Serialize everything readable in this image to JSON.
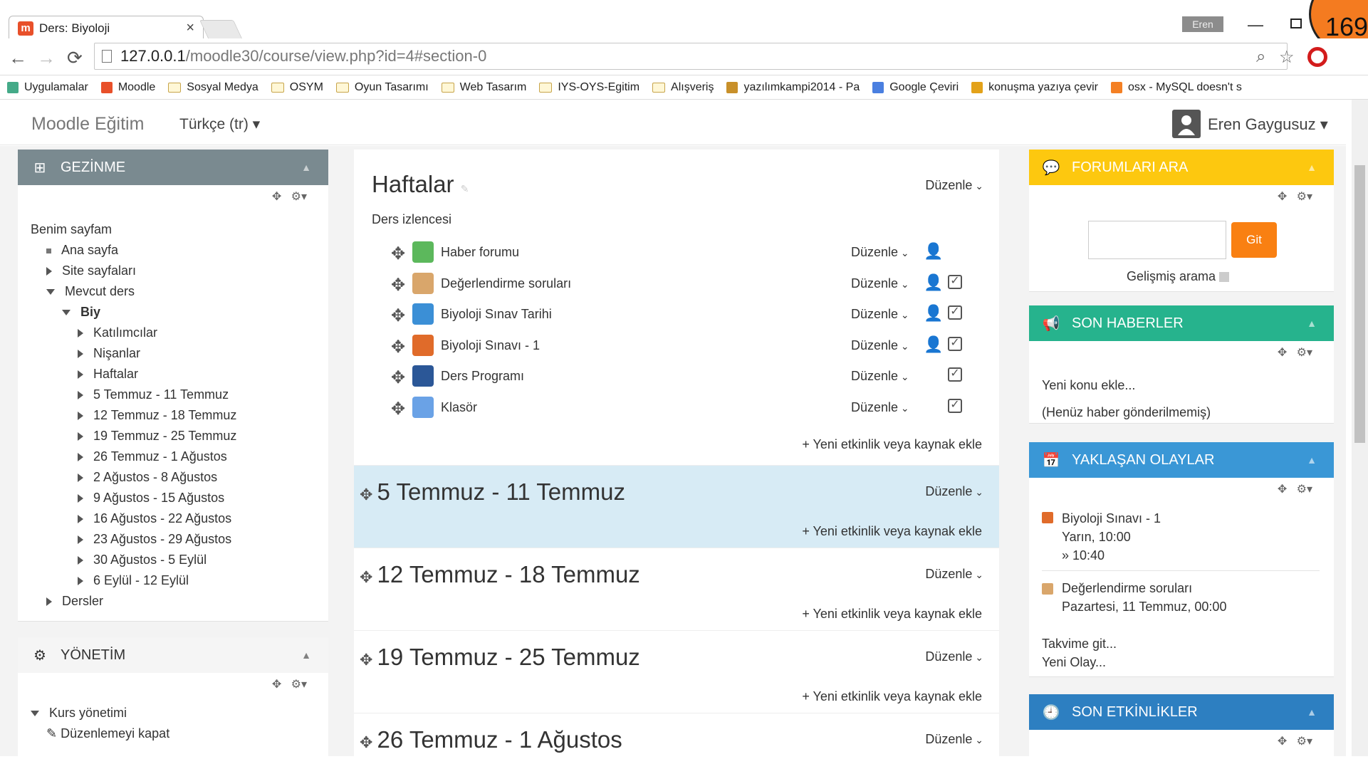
{
  "browser": {
    "tab_title": "Ders: Biyoloji",
    "tab_close": "×",
    "user_chip": "Eren",
    "counter": "169",
    "url_host": "127.0.0.1",
    "url_path": "/moodle30/course/view.php?id=4#section-0",
    "bookmarks": [
      {
        "label": "Uygulamalar",
        "icon": "apps-grid-icon"
      },
      {
        "label": "Moodle",
        "icon": "moodle-icon"
      },
      {
        "label": "Sosyal Medya",
        "icon": "folder-icon"
      },
      {
        "label": "OSYM",
        "icon": "folder-icon"
      },
      {
        "label": "Oyun Tasarımı",
        "icon": "folder-icon"
      },
      {
        "label": "Web Tasarım",
        "icon": "folder-icon"
      },
      {
        "label": "IYS-OYS-Egitim",
        "icon": "folder-icon"
      },
      {
        "label": "Alışveriş",
        "icon": "folder-icon"
      },
      {
        "label": "yazılımkampi2014 - Pa",
        "icon": "leopard-icon"
      },
      {
        "label": "Google Çeviri",
        "icon": "translate-icon"
      },
      {
        "label": "konuşma yazıya çevir",
        "icon": "chrome-icon"
      },
      {
        "label": "osx - MySQL doesn't s",
        "icon": "stack-icon"
      }
    ]
  },
  "navbar": {
    "brand": "Moodle Eğitim",
    "language": "Türkçe (tr)",
    "user_name": "Eren Gaygusuz"
  },
  "left": {
    "nav_title": "GEZİNME",
    "nav_tree": [
      {
        "label": "Benim sayfam",
        "level": 0,
        "marker": "none"
      },
      {
        "label": "Ana sayfa",
        "level": 1,
        "marker": "dot"
      },
      {
        "label": "Site sayfaları",
        "level": 1,
        "marker": "right"
      },
      {
        "label": "Mevcut ders",
        "level": 1,
        "marker": "down"
      },
      {
        "label": "Biy",
        "level": 2,
        "marker": "down"
      },
      {
        "label": "Katılımcılar",
        "level": 3,
        "marker": "right"
      },
      {
        "label": "Nişanlar",
        "level": 3,
        "marker": "right"
      },
      {
        "label": "Haftalar",
        "level": 3,
        "marker": "right"
      },
      {
        "label": "5 Temmuz - 11 Temmuz",
        "level": 3,
        "marker": "right"
      },
      {
        "label": "12 Temmuz - 18 Temmuz",
        "level": 3,
        "marker": "right"
      },
      {
        "label": "19 Temmuz - 25 Temmuz",
        "level": 3,
        "marker": "right"
      },
      {
        "label": "26 Temmuz - 1 Ağustos",
        "level": 3,
        "marker": "right"
      },
      {
        "label": "2 Ağustos - 8 Ağustos",
        "level": 3,
        "marker": "right"
      },
      {
        "label": "9 Ağustos - 15 Ağustos",
        "level": 3,
        "marker": "right"
      },
      {
        "label": "16 Ağustos - 22 Ağustos",
        "level": 3,
        "marker": "right"
      },
      {
        "label": "23 Ağustos - 29 Ağustos",
        "level": 3,
        "marker": "right"
      },
      {
        "label": "30 Ağustos - 5 Eylül",
        "level": 3,
        "marker": "right"
      },
      {
        "label": "6 Eylül - 12 Eylül",
        "level": 3,
        "marker": "right"
      },
      {
        "label": "Dersler",
        "level": 1,
        "marker": "right"
      }
    ],
    "admin_title": "YÖNETİM",
    "admin_tree": [
      {
        "label": "Kurs yönetimi",
        "marker": "down"
      },
      {
        "label": "Düzenlemeyi kapat",
        "marker": "pencil"
      }
    ]
  },
  "main": {
    "edit_label": "Düzenle",
    "add_label": "Yeni etkinlik veya kaynak ekle",
    "section0_title": "Haftalar",
    "section0_summary": "Ders izlencesi",
    "activities": [
      {
        "name": "Haber forumu",
        "icon": "forum-icon",
        "color": "#5cb85c",
        "checkbox": false
      },
      {
        "name": "Değerlendirme soruları",
        "icon": "feedback-icon",
        "color": "#d9a66b",
        "checkbox": true
      },
      {
        "name": "Biyoloji Sınav Tarihi",
        "icon": "question-icon",
        "color": "#3b8fd6",
        "checkbox": true
      },
      {
        "name": "Biyoloji Sınavı - 1",
        "icon": "quiz-icon",
        "color": "#e06b2a",
        "checkbox": true
      },
      {
        "name": "Ders Programı",
        "icon": "word-doc-icon",
        "color": "#2b5797",
        "checkbox": true
      },
      {
        "name": "Klasör",
        "icon": "folder-icon",
        "color": "#6aa2e6",
        "checkbox": true
      }
    ],
    "weeks": [
      "5 Temmuz - 11 Temmuz",
      "12 Temmuz - 18 Temmuz",
      "19 Temmuz - 25 Temmuz",
      "26 Temmuz - 1 Ağustos"
    ]
  },
  "right": {
    "search_title": "FORUMLARI ARA",
    "search_button": "Git",
    "advanced_search": "Gelişmiş arama",
    "news_title": "SON HABERLER",
    "news_add": "Yeni konu ekle...",
    "news_empty": "(Henüz haber gönderilmemiş)",
    "events_title": "YAKLAŞAN OLAYLAR",
    "event1_name": "Biyoloji Sınavı - 1",
    "event1_time": "Yarın, 10:00",
    "event1_end": "» 10:40",
    "event2_name": "Değerlendirme soruları",
    "event2_time": "Pazartesi, 11 Temmuz, 00:00",
    "goto_calendar": "Takvime git...",
    "new_event": "Yeni Olay...",
    "recent_title": "SON ETKİNLİKLER",
    "colors": {
      "search": "#fdc80f",
      "news": "#26b38d",
      "events": "#3a97d6",
      "recent": "#2d7fc1",
      "git": "#f98012",
      "nav": "#7a8a90",
      "highlight": "#d7ebf5"
    }
  }
}
